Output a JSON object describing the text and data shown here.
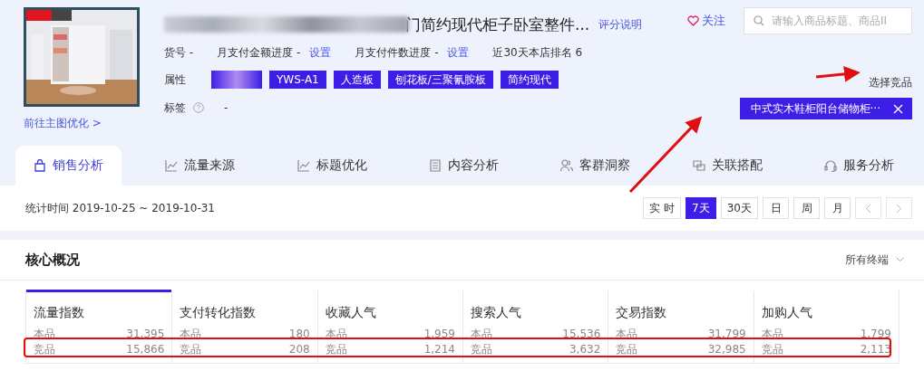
{
  "product": {
    "title": "门简约现代柜子卧室整件...",
    "rating_link": "评分说明",
    "follow": "关注",
    "search": {
      "placeholder": "请输入商品标题、商品II"
    },
    "info": [
      {
        "label": "货号 -"
      },
      {
        "label": "月支付金额进度 -",
        "link": "设置"
      },
      {
        "label": "月支付件数进度 -",
        "link": "设置"
      },
      {
        "label": "近30天本店排名 6"
      }
    ],
    "attr_label": "属性",
    "attrs": [
      {
        "blurred": true
      },
      {
        "text": "YWS-A1",
        "blurred": false
      },
      {
        "text": "人造板",
        "blurred": false
      },
      {
        "text": "刨花板/三聚氰胺板",
        "blurred": false
      },
      {
        "text": "简约现代",
        "blurred": false
      }
    ],
    "tag_label": "标签",
    "tag_value": "-",
    "main_image_link": "前往主图优化 >",
    "compare_label": "选择竞品",
    "compare_item": "中式实木鞋柜阳台储物柜···"
  },
  "tabs": [
    {
      "label": "销售分析",
      "selected": true
    },
    {
      "label": "流量来源",
      "selected": false
    },
    {
      "label": "标题优化",
      "selected": false
    },
    {
      "label": "内容分析",
      "selected": false
    },
    {
      "label": "客群洞察",
      "selected": false
    },
    {
      "label": "关联搭配",
      "selected": false
    },
    {
      "label": "服务分析",
      "selected": false
    }
  ],
  "period": {
    "label": "统计时间 2019-10-25 ~ 2019-10-31",
    "buttons": [
      {
        "label": "实 时",
        "selected": false
      },
      {
        "label": "7天",
        "selected": true
      },
      {
        "label": "30天",
        "selected": false
      },
      {
        "label": "日",
        "selected": false
      },
      {
        "label": "周",
        "selected": false
      },
      {
        "label": "月",
        "selected": false
      }
    ]
  },
  "overview": {
    "title": "核心概况",
    "terminal": "所有终端",
    "metrics": [
      {
        "name": "流量指数",
        "selected": true,
        "own_label": "本品",
        "own": "31,395",
        "rival_label": "竞品",
        "rival": "15,866"
      },
      {
        "name": "支付转化指数",
        "selected": false,
        "own_label": "本品",
        "own": "180",
        "rival_label": "竞品",
        "rival": "208"
      },
      {
        "name": "收藏人气",
        "selected": false,
        "own_label": "本品",
        "own": "1,959",
        "rival_label": "竞品",
        "rival": "1,214"
      },
      {
        "name": "搜索人气",
        "selected": false,
        "own_label": "本品",
        "own": "15,536",
        "rival_label": "竞品",
        "rival": "3,632"
      },
      {
        "name": "交易指数",
        "selected": false,
        "own_label": "本品",
        "own": "31,799",
        "rival_label": "竞品",
        "rival": "32,985"
      },
      {
        "name": "加购人气",
        "selected": false,
        "own_label": "本品",
        "own": "1,799",
        "rival_label": "竞品",
        "rival": "2,113"
      }
    ]
  }
}
